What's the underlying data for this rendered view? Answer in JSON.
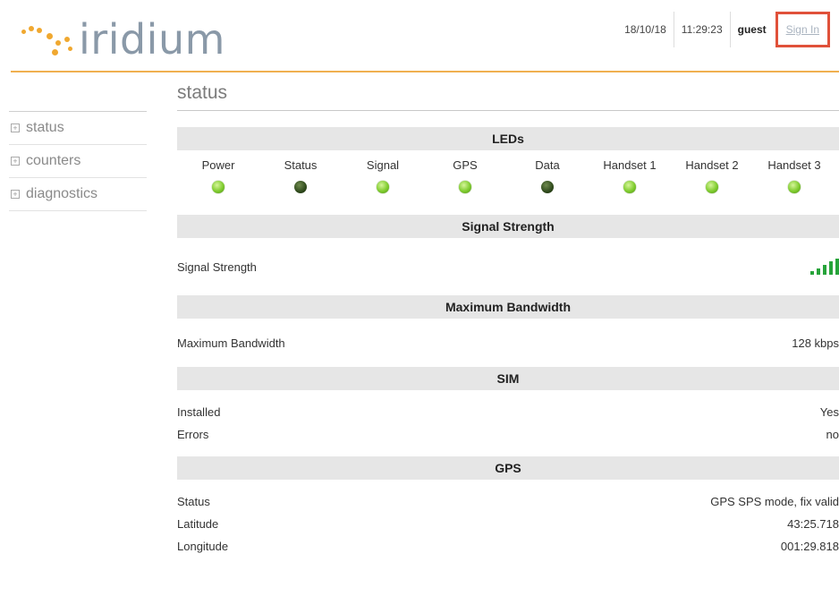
{
  "brand": {
    "name": "iridium",
    "dot_color": "#f0a830",
    "text_color": "#8a99a8"
  },
  "topbar": {
    "date": "18/10/18",
    "time": "11:29:23",
    "user": "guest",
    "signin_label": "Sign In",
    "highlight_color": "#e0513a"
  },
  "sidebar": {
    "items": [
      {
        "label": "status"
      },
      {
        "label": "counters"
      },
      {
        "label": "diagnostics"
      }
    ]
  },
  "main": {
    "title": "status",
    "leds": {
      "heading": "LEDs",
      "items": [
        {
          "label": "Power",
          "state": "on"
        },
        {
          "label": "Status",
          "state": "off"
        },
        {
          "label": "Signal",
          "state": "on"
        },
        {
          "label": "GPS",
          "state": "on"
        },
        {
          "label": "Data",
          "state": "off"
        },
        {
          "label": "Handset 1",
          "state": "on"
        },
        {
          "label": "Handset 2",
          "state": "on"
        },
        {
          "label": "Handset 3",
          "state": "on"
        }
      ]
    },
    "signal": {
      "heading": "Signal Strength",
      "label": "Signal Strength",
      "bars_filled": 5,
      "bars_total": 5,
      "bar_color": "#27a43a"
    },
    "bandwidth": {
      "heading": "Maximum Bandwidth",
      "label": "Maximum Bandwidth",
      "value": "128 kbps"
    },
    "sim": {
      "heading": "SIM",
      "rows": [
        {
          "label": "Installed",
          "value": "Yes"
        },
        {
          "label": "Errors",
          "value": "no"
        }
      ]
    },
    "gps": {
      "heading": "GPS",
      "rows": [
        {
          "label": "Status",
          "value": "GPS SPS mode, fix valid"
        },
        {
          "label": "Latitude",
          "value": "43:25.718"
        },
        {
          "label": "Longitude",
          "value": "001:29.818"
        }
      ]
    }
  }
}
